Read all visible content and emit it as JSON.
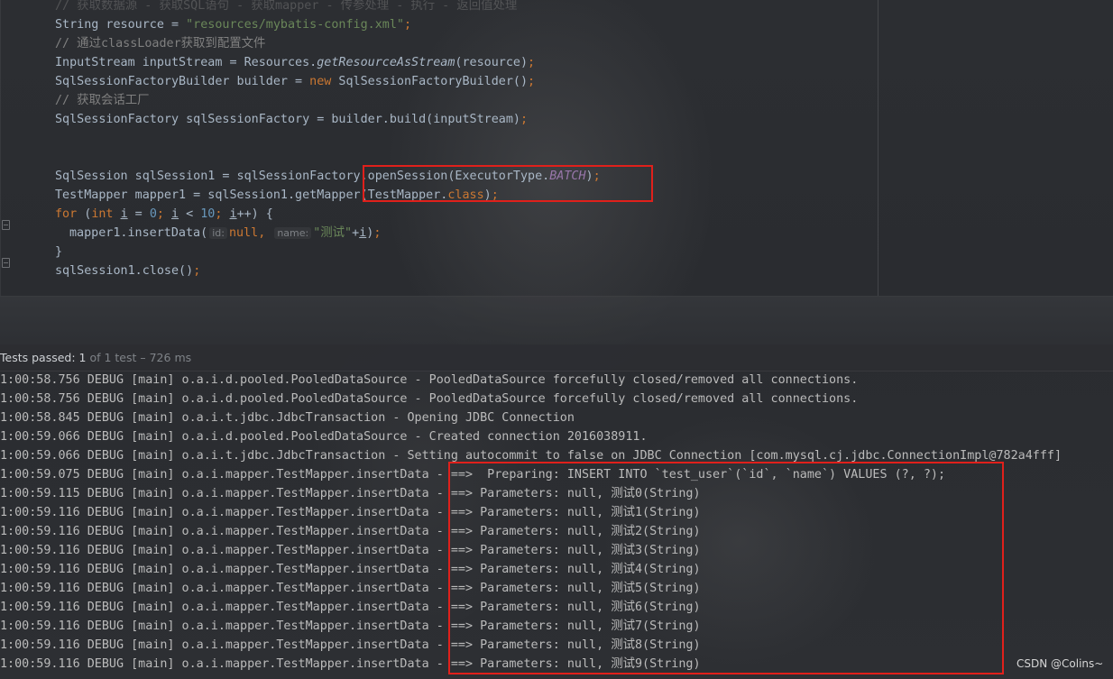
{
  "editor": {
    "lines": [
      {
        "segments": [
          {
            "t": "// 获取数据源 - 获取SQL语句 - 获取mapper - 传参处理 - 执行 - 返回值处理",
            "c": "cm"
          }
        ]
      },
      {
        "segments": [
          {
            "t": "String resource = "
          },
          {
            "t": "\"resources/mybatis-config.xml\"",
            "c": "str"
          },
          {
            "t": ";",
            "c": "kw"
          }
        ]
      },
      {
        "segments": [
          {
            "t": "// 通过classLoader获取到配置文件",
            "c": "cm"
          }
        ]
      },
      {
        "segments": [
          {
            "t": "InputStream inputStream = Resources."
          },
          {
            "t": "getResourceAsStream",
            "c": "it"
          },
          {
            "t": "(resource)"
          },
          {
            "t": ";",
            "c": "kw"
          }
        ]
      },
      {
        "segments": [
          {
            "t": "SqlSessionFactoryBuilder builder = "
          },
          {
            "t": "new",
            "c": "kw"
          },
          {
            "t": " SqlSessionFactoryBuilder()"
          },
          {
            "t": ";",
            "c": "kw"
          }
        ]
      },
      {
        "segments": [
          {
            "t": "// 获取会话工厂",
            "c": "cm"
          }
        ]
      },
      {
        "segments": [
          {
            "t": "SqlSessionFactory sqlSessionFactory = builder.build(inputStream)"
          },
          {
            "t": ";",
            "c": "kw"
          }
        ]
      },
      {
        "segments": []
      },
      {
        "segments": []
      },
      {
        "segments": [
          {
            "t": "SqlSession sqlSession1 = sqlSessionFactory.openSession(ExecutorType."
          },
          {
            "t": "BATCH",
            "c": "cst"
          },
          {
            "t": ")"
          },
          {
            "t": ";",
            "c": "kw"
          }
        ]
      },
      {
        "segments": [
          {
            "t": "TestMapper mapper1 = sqlSession1.getMapper(TestMapper."
          },
          {
            "t": "class",
            "c": "kw"
          },
          {
            "t": ")"
          },
          {
            "t": ";",
            "c": "kw"
          }
        ]
      },
      {
        "segments": [
          {
            "t": "for",
            "c": "kw"
          },
          {
            "t": " ("
          },
          {
            "t": "int",
            "c": "kw"
          },
          {
            "t": " "
          },
          {
            "t": "i",
            "c": "ul"
          },
          {
            "t": " = "
          },
          {
            "t": "0",
            "c": "num"
          },
          {
            "t": "; ",
            "c": "kw"
          },
          {
            "t": "i",
            "c": "ul"
          },
          {
            "t": " < "
          },
          {
            "t": "10",
            "c": "num"
          },
          {
            "t": "; ",
            "c": "kw"
          },
          {
            "t": "i",
            "c": "ul"
          },
          {
            "t": "++) {"
          }
        ]
      },
      {
        "indent": true,
        "segments": [
          {
            "t": "mapper1.insertData("
          },
          {
            "t": "id:",
            "c": "hint"
          },
          {
            "t": "null",
            "c": "kw"
          },
          {
            "t": ", ",
            "c": "kw"
          },
          {
            "t": "name:",
            "c": "hint"
          },
          {
            "t": "\"测试\"",
            "c": "str"
          },
          {
            "t": "+"
          },
          {
            "t": "i",
            "c": "ul"
          },
          {
            "t": ")"
          },
          {
            "t": ";",
            "c": "kw"
          }
        ]
      },
      {
        "segments": [
          {
            "t": "}"
          }
        ]
      },
      {
        "segments": [
          {
            "t": "sqlSession1.close()"
          },
          {
            "t": ";",
            "c": "kw"
          }
        ]
      }
    ]
  },
  "test_status": {
    "passed_label": "Tests passed: ",
    "count": "1",
    "detail": " of 1 test – 726 ms"
  },
  "console": {
    "lines": [
      "1:00:58.756 DEBUG [main] o.a.i.d.pooled.PooledDataSource - PooledDataSource forcefully closed/removed all connections.",
      "1:00:58.756 DEBUG [main] o.a.i.d.pooled.PooledDataSource - PooledDataSource forcefully closed/removed all connections.",
      "1:00:58.845 DEBUG [main] o.a.i.t.jdbc.JdbcTransaction - Opening JDBC Connection",
      "1:00:59.066 DEBUG [main] o.a.i.d.pooled.PooledDataSource - Created connection 2016038911.",
      "1:00:59.066 DEBUG [main] o.a.i.t.jdbc.JdbcTransaction - Setting autocommit to false on JDBC Connection [com.mysql.cj.jdbc.ConnectionImpl@782a4fff]",
      "1:00:59.075 DEBUG [main] o.a.i.mapper.TestMapper.insertData - ==>  Preparing: INSERT INTO `test_user`(`id`, `name`) VALUES (?, ?);",
      "1:00:59.115 DEBUG [main] o.a.i.mapper.TestMapper.insertData - ==> Parameters: null, 测试0(String)",
      "1:00:59.116 DEBUG [main] o.a.i.mapper.TestMapper.insertData - ==> Parameters: null, 测试1(String)",
      "1:00:59.116 DEBUG [main] o.a.i.mapper.TestMapper.insertData - ==> Parameters: null, 测试2(String)",
      "1:00:59.116 DEBUG [main] o.a.i.mapper.TestMapper.insertData - ==> Parameters: null, 测试3(String)",
      "1:00:59.116 DEBUG [main] o.a.i.mapper.TestMapper.insertData - ==> Parameters: null, 测试4(String)",
      "1:00:59.116 DEBUG [main] o.a.i.mapper.TestMapper.insertData - ==> Parameters: null, 测试5(String)",
      "1:00:59.116 DEBUG [main] o.a.i.mapper.TestMapper.insertData - ==> Parameters: null, 测试6(String)",
      "1:00:59.116 DEBUG [main] o.a.i.mapper.TestMapper.insertData - ==> Parameters: null, 测试7(String)",
      "1:00:59.116 DEBUG [main] o.a.i.mapper.TestMapper.insertData - ==> Parameters: null, 测试8(String)",
      "1:00:59.116 DEBUG [main] o.a.i.mapper.TestMapper.insertData - ==> Parameters: null, 测试9(String)"
    ]
  },
  "watermark": "CSDN @Colins~",
  "colors": {
    "highlight_border": "#e0201b",
    "keyword": "#cc7832",
    "string": "#6a8759",
    "comment": "#808080",
    "number": "#6897bb",
    "constant": "#9876aa"
  }
}
